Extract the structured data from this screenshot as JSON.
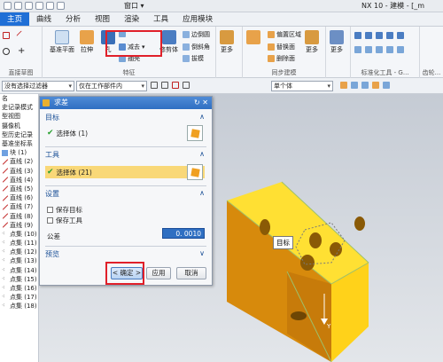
{
  "titlebar": {
    "window_menu": "窗口 ▾",
    "app_title": "NX 10 - 建模 - [_m"
  },
  "menu": {
    "tabs": [
      "主页",
      "曲线",
      "分析",
      "视图",
      "渲染",
      "工具",
      "应用模块"
    ]
  },
  "ribbon": {
    "direct_sketch": "直接草图",
    "datum_plane": "基准平面",
    "extrude": "拉伸",
    "hole": "孔",
    "subtract": "减去",
    "shell": "抽壳",
    "trim_body": "修剪体",
    "draft": "拔模",
    "edge_blend": "边倒圆",
    "chamfer": "倒斜角",
    "more1": "更多",
    "feature_group": "特征",
    "offset_region": "偏置区域",
    "replace_face": "替换面",
    "delete_face": "删除面",
    "more2": "更多",
    "sync_group": "同步建模",
    "more3": "更多",
    "std_tools_group": "标准化工具 - G...",
    "gear_group": "齿轮..."
  },
  "filters": {
    "selection_filter": "没有选择过滤器",
    "scope": "仅在工作部件内",
    "snap": "单个体"
  },
  "nav": {
    "rows": [
      {
        "label": "名",
        "icon": "none"
      },
      {
        "label": "史记录模式",
        "icon": "none"
      },
      {
        "label": "型视图",
        "icon": "none"
      },
      {
        "label": "摄像机",
        "icon": "none"
      },
      {
        "label": "型历史记录",
        "icon": "none"
      },
      {
        "label": "基准坐标系",
        "icon": "none"
      },
      {
        "label": "块 (1)",
        "icon": "block"
      },
      {
        "label": "直线 (2)",
        "icon": "line"
      },
      {
        "label": "直线 (3)",
        "icon": "line"
      },
      {
        "label": "直线 (4)",
        "icon": "line"
      },
      {
        "label": "直线 (5)",
        "icon": "line"
      },
      {
        "label": "直线 (6)",
        "icon": "line"
      },
      {
        "label": "直线 (7)",
        "icon": "line"
      },
      {
        "label": "直线 (8)",
        "icon": "line"
      },
      {
        "label": "直线 (9)",
        "icon": "line"
      },
      {
        "label": "点集 (10)",
        "icon": "points"
      },
      {
        "label": "点集 (11)",
        "icon": "points"
      },
      {
        "label": "点集 (12)",
        "icon": "points"
      },
      {
        "label": "点集 (13)",
        "icon": "points"
      },
      {
        "label": "点集 (14)",
        "icon": "points"
      },
      {
        "label": "点集 (15)",
        "icon": "points"
      },
      {
        "label": "点集 (16)",
        "icon": "points"
      },
      {
        "label": "点集 (17)",
        "icon": "points"
      },
      {
        "label": "点集 (18)",
        "icon": "points"
      }
    ]
  },
  "dialog": {
    "title": "求差",
    "target_section": "目标",
    "target_value": "选择体 (1)",
    "tool_section": "工具",
    "tool_value": "选择体 (21)",
    "settings_section": "设置",
    "keep_target": "保存目标",
    "keep_tool": "保存工具",
    "tolerance_label": "公差",
    "tolerance_value": "0. 0010",
    "preview_section": "预览",
    "ok": "< 确定 >",
    "apply": "应用",
    "cancel": "取消"
  },
  "viewport": {
    "target_label": "目标",
    "y_axis": "Y"
  },
  "colors": {
    "accent": "#1f6fd6",
    "highlight": "#f9d878",
    "red_box": "#e0202a",
    "cube_yellow": "#ffd21a",
    "cube_shadow": "#c07a10"
  }
}
